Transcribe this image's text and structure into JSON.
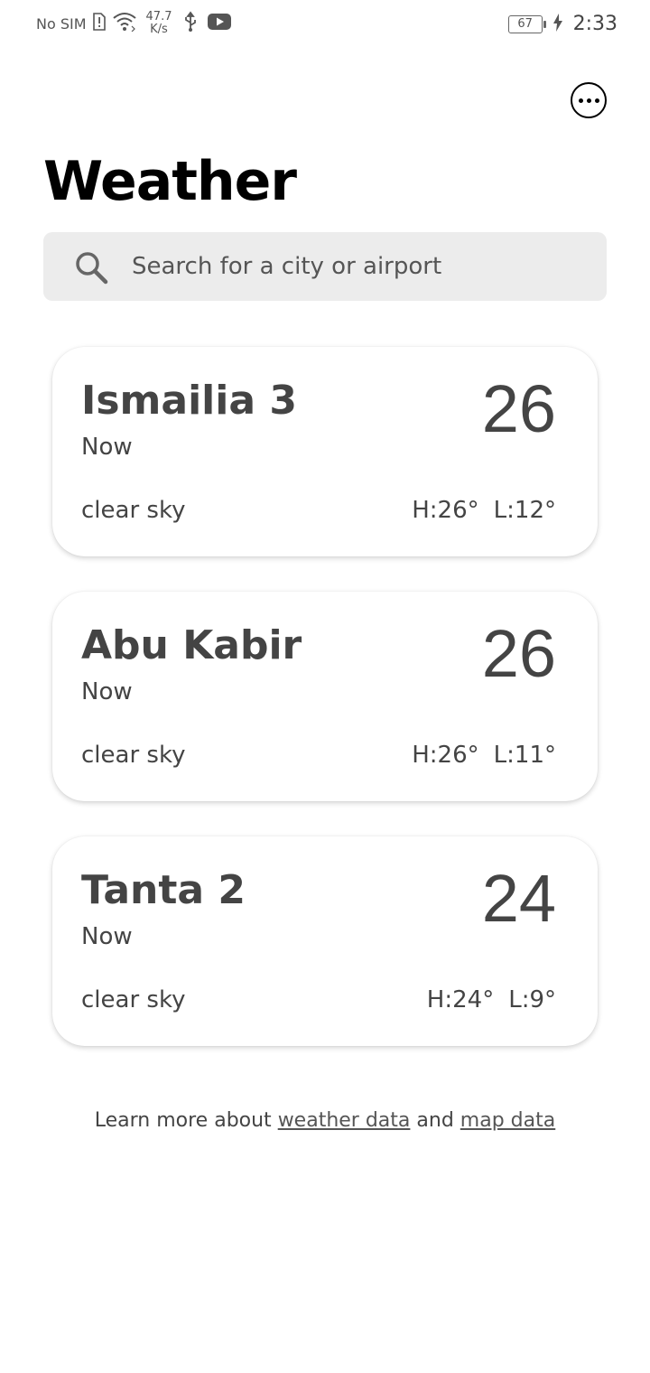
{
  "status_bar": {
    "carrier": "No SIM",
    "net_speed_value": "47.7",
    "net_speed_unit": "K/s",
    "battery": "67",
    "time": "2:33"
  },
  "header": {
    "title": "Weather",
    "menu_icon": "more-horizontal-circle-icon"
  },
  "search": {
    "placeholder": "Search for a city or airport",
    "icon": "search-icon"
  },
  "cards": [
    {
      "city": "Ismailia 3",
      "time": "Now",
      "temp": "26",
      "condition": "clear sky",
      "high": "H:26°",
      "low": "L:12°"
    },
    {
      "city": "Abu Kabir",
      "time": "Now",
      "temp": "26",
      "condition": "clear sky",
      "high": "H:26°",
      "low": "L:11°"
    },
    {
      "city": "Tanta 2",
      "time": "Now",
      "temp": "24",
      "condition": "clear sky",
      "high": "H:24°",
      "low": "L:9°"
    }
  ],
  "footer": {
    "prefix": "Learn more about",
    "link1": "weather data",
    "middle": "and",
    "link2": "map data"
  }
}
